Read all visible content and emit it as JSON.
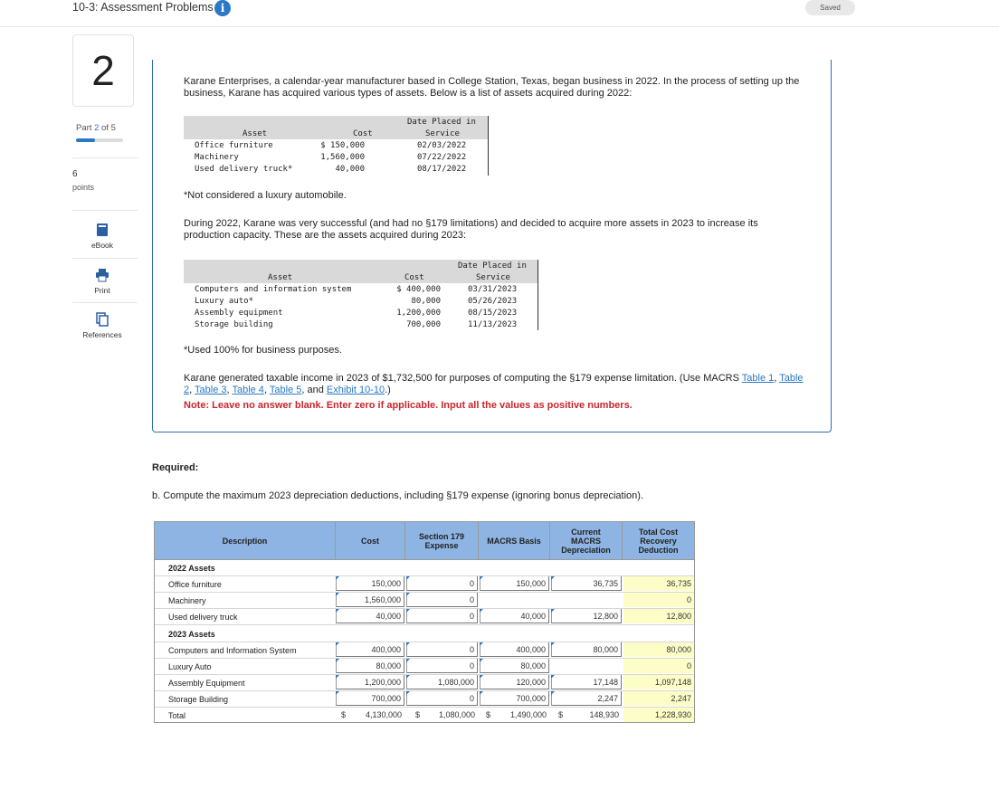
{
  "header": {
    "title": "10-3: Assessment Problems",
    "info_icon": "i",
    "saved_label": "Saved"
  },
  "sidebar": {
    "question_number": "2",
    "part_prefix": "Part",
    "part_current": "2",
    "part_of": "of 5",
    "part_progress": 0.4,
    "points_value": "6",
    "points_label": "points",
    "tools": [
      {
        "label": "eBook",
        "icon": "book-icon"
      },
      {
        "label": "Print",
        "icon": "print-icon"
      },
      {
        "label": "References",
        "icon": "references-icon"
      }
    ]
  },
  "question": {
    "intro": "Karane Enterprises, a calendar-year manufacturer based in College Station, Texas, began business in 2022. In the process of setting up the business, Karane has acquired various types of assets. Below is a list of assets acquired during 2022:",
    "table1": {
      "h_date": "Date Placed in",
      "h_asset": "Asset",
      "h_cost": "Cost",
      "h_service": "Service",
      "rows": [
        {
          "asset": "Office furniture",
          "cost": "$ 150,000",
          "date": "02/03/2022"
        },
        {
          "asset": "Machinery",
          "cost": "1,560,000",
          "date": "07/22/2022"
        },
        {
          "asset": "Used delivery truck*",
          "cost": "40,000",
          "date": "08/17/2022"
        }
      ]
    },
    "footnote1": "*Not considered a luxury automobile.",
    "para2": "During 2022, Karane was very successful (and had no §179 limitations) and decided to acquire more assets in 2023 to increase its production capacity. These are the assets acquired during 2023:",
    "table2": {
      "h_date": "Date Placed in",
      "h_asset": "Asset",
      "h_cost": "Cost",
      "h_service": "Service",
      "rows": [
        {
          "asset": "Computers and information system",
          "cost": "$ 400,000",
          "date": "03/31/2023"
        },
        {
          "asset": "Luxury auto*",
          "cost": "80,000",
          "date": "05/26/2023"
        },
        {
          "asset": "Assembly equipment",
          "cost": "1,200,000",
          "date": "08/15/2023"
        },
        {
          "asset": "Storage building",
          "cost": "700,000",
          "date": "11/13/2023"
        }
      ]
    },
    "footnote2": "*Used 100% for business purposes.",
    "para3_start": "Karane generated taxable income in 2023 of $1,732,500 for purposes of computing the §179 expense limitation. (Use MACRS ",
    "links": [
      "Table 1",
      "Table 2",
      "Table 3",
      "Table 4",
      "Table 5",
      "Exhibit 10-10"
    ],
    "sep_comma": ", ",
    "sep_and": ", and ",
    "para3_end": ".)",
    "note": "Note: Leave no answer blank. Enter zero if applicable. Input all the values as positive numbers."
  },
  "required": {
    "heading": "Required:",
    "part_b": "b. Compute the maximum 2023 depreciation deductions, including §179 expense (ignoring bonus depreciation)."
  },
  "answer_table": {
    "headers": {
      "description": "Description",
      "cost": "Cost",
      "sec179_1": "Section 179",
      "sec179_2": "Expense",
      "macrs_basis": "MACRS Basis",
      "current_1": "Current",
      "current_2": "MACRS",
      "current_3": "Depreciation",
      "total_1": "Total Cost",
      "total_2": "Recovery",
      "total_3": "Deduction"
    },
    "dollar": "$",
    "section_2022": "2022 Assets",
    "section_2023": "2023 Assets",
    "rows": [
      {
        "desc": "Office furniture",
        "cost": "150,000",
        "sec179": "0",
        "basis": "150,000",
        "current": "36,735",
        "total": "36,735"
      },
      {
        "desc": "Machinery",
        "cost": "1,560,000",
        "sec179": "0",
        "basis": "",
        "current": "",
        "total": "0"
      },
      {
        "desc": "Used delivery truck",
        "cost": "40,000",
        "sec179": "0",
        "basis": "40,000",
        "current": "12,800",
        "total": "12,800"
      },
      {
        "desc": "Computers and Information System",
        "cost": "400,000",
        "sec179": "0",
        "basis": "400,000",
        "current": "80,000",
        "total": "80,000"
      },
      {
        "desc": "Luxury Auto",
        "cost": "80,000",
        "sec179": "0",
        "basis": "80,000",
        "current": "",
        "total": "0"
      },
      {
        "desc": "Assembly Equipment",
        "cost": "1,200,000",
        "sec179": "1,080,000",
        "basis": "120,000",
        "current": "17,148",
        "total": "1,097,148"
      },
      {
        "desc": "Storage Building",
        "cost": "700,000",
        "sec179": "0",
        "basis": "700,000",
        "current": "2,247",
        "total": "2,247"
      }
    ],
    "total_row": {
      "desc": "Total",
      "cost": "4,130,000",
      "sec179": "1,080,000",
      "basis": "1,490,000",
      "current": "148,930",
      "total": "1,228,930"
    }
  }
}
